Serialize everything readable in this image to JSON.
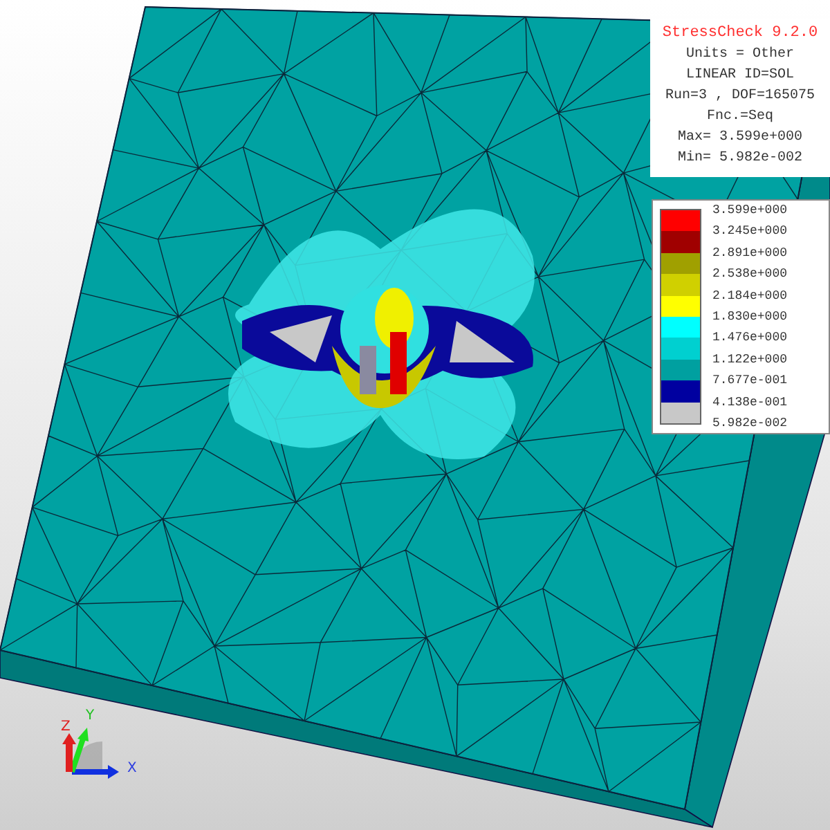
{
  "info": {
    "title": "StressCheck 9.2.0",
    "lines": [
      "Units = Other",
      "LINEAR ID=SOL",
      "Run=3 , DOF=165075",
      "Fnc.=Seq",
      "Max= 3.599e+000",
      "Min= 5.982e-002"
    ]
  },
  "legend": {
    "bands": [
      {
        "color": "#ff0000"
      },
      {
        "color": "#a00000"
      },
      {
        "color": "#a0a000"
      },
      {
        "color": "#d0d000"
      },
      {
        "color": "#ffff00"
      },
      {
        "color": "#00ffff"
      },
      {
        "color": "#00d0d0"
      },
      {
        "color": "#00a0a0"
      },
      {
        "color": "#0000a0"
      },
      {
        "color": "#c8c8c8"
      }
    ],
    "labels": [
      "3.599e+000",
      "3.245e+000",
      "2.891e+000",
      "2.538e+000",
      "2.184e+000",
      "1.830e+000",
      "1.476e+000",
      "1.122e+000",
      "7.677e-001",
      "4.138e-001",
      "5.982e-002"
    ]
  },
  "triad": {
    "x": "X",
    "y": "Y",
    "z": "Z"
  }
}
